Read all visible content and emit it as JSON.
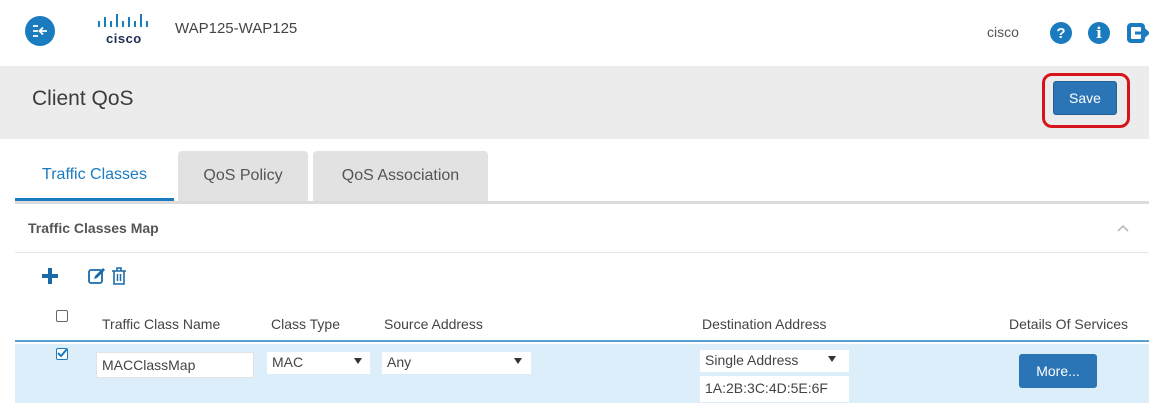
{
  "header": {
    "device_name": "WAP125-WAP125",
    "logo_text": "cisco",
    "username": "cisco",
    "help_glyph": "?",
    "info_glyph": "i",
    "icons": [
      "nav-toggle-icon",
      "cisco-logo",
      "help-icon",
      "info-icon",
      "logout-icon"
    ]
  },
  "page": {
    "title": "Client QoS",
    "save_label": "Save"
  },
  "tabs": [
    {
      "label": "Traffic Classes",
      "active": true
    },
    {
      "label": "QoS Policy",
      "active": false
    },
    {
      "label": "QoS Association",
      "active": false
    }
  ],
  "panel": {
    "title": "Traffic Classes Map",
    "toolbar_icons": [
      "add-icon",
      "edit-icon",
      "delete-icon"
    ]
  },
  "table": {
    "headers": [
      "Traffic Class Name",
      "Class Type",
      "Source Address",
      "Destination Address",
      "Details Of Services"
    ],
    "rows": [
      {
        "selected": true,
        "name": "MACClassMap",
        "class_type": "MAC",
        "source_address": "Any",
        "destination_mode": "Single Address",
        "destination_value": "1A:2B:3C:4D:5E:6F",
        "details_label": "More..."
      }
    ]
  },
  "colors": {
    "brand_blue": "#1a7bbf",
    "button_blue": "#2b75b6",
    "highlight_red": "#d8141b",
    "selected_row": "#dbeefa",
    "title_band": "#ececec"
  }
}
